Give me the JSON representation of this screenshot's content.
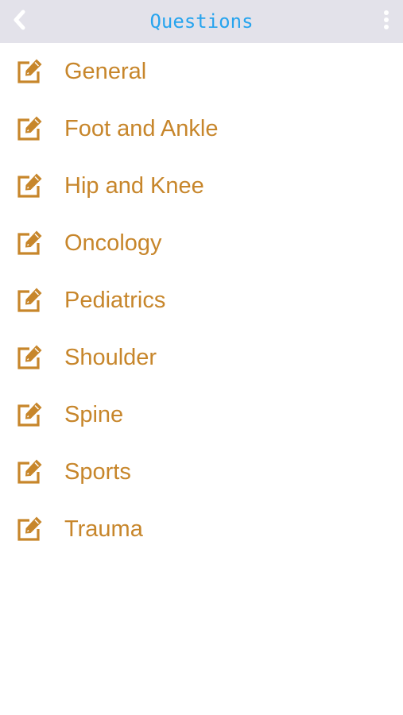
{
  "header": {
    "title": "Questions",
    "back_icon": "chevron-left-icon",
    "menu_icon": "more-vertical-icon"
  },
  "colors": {
    "header_background": "#e3e2ea",
    "title": "#27a4ee",
    "accent": "#c7862b",
    "header_icon": "#ffffff"
  },
  "list": {
    "item_icon": "edit-icon",
    "items": [
      {
        "label": "General"
      },
      {
        "label": "Foot and Ankle"
      },
      {
        "label": "Hip and Knee"
      },
      {
        "label": "Oncology"
      },
      {
        "label": "Pediatrics"
      },
      {
        "label": "Shoulder"
      },
      {
        "label": "Spine"
      },
      {
        "label": "Sports"
      },
      {
        "label": "Trauma"
      }
    ]
  }
}
